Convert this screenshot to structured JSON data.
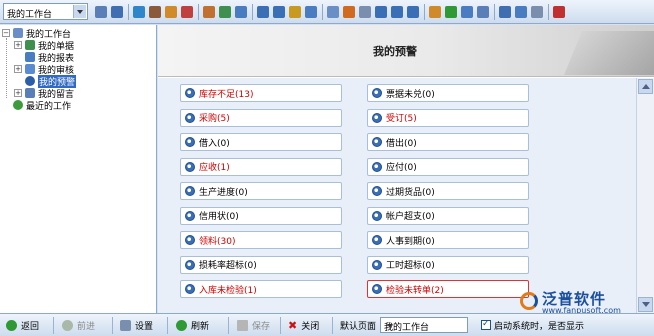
{
  "toolbar": {
    "workspace_select": "我的工作台",
    "icons": [
      "new-icon",
      "print-icon",
      "refresh-icon",
      "user-icon",
      "folder-icon",
      "flag-icon",
      "gift-icon",
      "image-icon",
      "arrow-icon",
      "forward-icon",
      "help-icon",
      "dollar-icon",
      "cart-icon",
      "list-icon",
      "report-icon",
      "doc-icon",
      "note-icon",
      "calendar-icon",
      "check-icon",
      "pen-icon",
      "chart-icon",
      "computer-icon",
      "clock-icon",
      "window-icon",
      "tile-icon",
      "copy-icon",
      "exit-icon"
    ]
  },
  "tree": {
    "root": "我的工作台",
    "items": [
      "我的单据",
      "我的报表",
      "我的审核",
      "我的预警",
      "我的留言"
    ],
    "selected": "我的预警",
    "recent": "最近的工作"
  },
  "main": {
    "title": "我的预警",
    "alerts": [
      {
        "label": "库存不足(13)",
        "red": true
      },
      {
        "label": "票据未兑(0)",
        "red": false
      },
      {
        "label": "采购(5)",
        "red": true
      },
      {
        "label": "受订(5)",
        "red": true
      },
      {
        "label": "借入(0)",
        "red": false
      },
      {
        "label": "借出(0)",
        "red": false
      },
      {
        "label": "应收(1)",
        "red": true
      },
      {
        "label": "应付(0)",
        "red": false
      },
      {
        "label": "生产进度(0)",
        "red": false
      },
      {
        "label": "过期货品(0)",
        "red": false
      },
      {
        "label": "信用状(0)",
        "red": false
      },
      {
        "label": "帐户超支(0)",
        "red": false
      },
      {
        "label": "领料(30)",
        "red": true
      },
      {
        "label": "人事到期(0)",
        "red": false
      },
      {
        "label": "损耗率超标(0)",
        "red": false
      },
      {
        "label": "工时超标(0)",
        "red": false
      },
      {
        "label": "入库未检验(1)",
        "red": true
      },
      {
        "label": "检验未转单(2)",
        "red": true
      }
    ]
  },
  "watermark": {
    "name": "泛普软件",
    "url": "www.fanpusoft.com"
  },
  "bottom": {
    "back": "返回",
    "forward": "前进",
    "settings": "设置",
    "refresh": "刷新",
    "save": "保存",
    "close": "关闭",
    "default_page_label": "默认页面",
    "default_page_value": "我的工作台",
    "startup_label": "启动系统时，是否显示"
  }
}
